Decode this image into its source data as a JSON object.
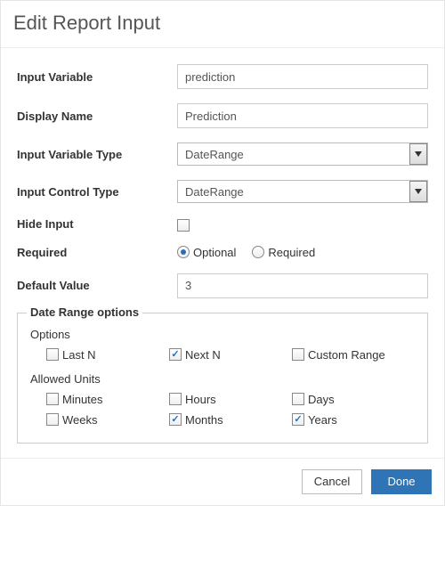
{
  "title": "Edit Report Input",
  "form": {
    "input_variable": {
      "label": "Input Variable",
      "value": "prediction"
    },
    "display_name": {
      "label": "Display Name",
      "value": "Prediction"
    },
    "input_variable_type": {
      "label": "Input Variable Type",
      "value": "DateRange"
    },
    "input_control_type": {
      "label": "Input Control Type",
      "value": "DateRange"
    },
    "hide_input": {
      "label": "Hide Input",
      "checked": false
    },
    "required": {
      "label": "Required",
      "options": {
        "optional": "Optional",
        "required": "Required"
      },
      "selected": "optional"
    },
    "default_value": {
      "label": "Default Value",
      "value": "3"
    }
  },
  "date_range": {
    "legend": "Date Range options",
    "options_label": "Options",
    "options": {
      "last_n": {
        "label": "Last N",
        "checked": false
      },
      "next_n": {
        "label": "Next N",
        "checked": true
      },
      "custom_range": {
        "label": "Custom Range",
        "checked": false
      }
    },
    "units_label": "Allowed Units",
    "units": {
      "minutes": {
        "label": "Minutes",
        "checked": false
      },
      "hours": {
        "label": "Hours",
        "checked": false
      },
      "days": {
        "label": "Days",
        "checked": false
      },
      "weeks": {
        "label": "Weeks",
        "checked": false
      },
      "months": {
        "label": "Months",
        "checked": true
      },
      "years": {
        "label": "Years",
        "checked": true
      }
    }
  },
  "footer": {
    "cancel": "Cancel",
    "done": "Done"
  }
}
